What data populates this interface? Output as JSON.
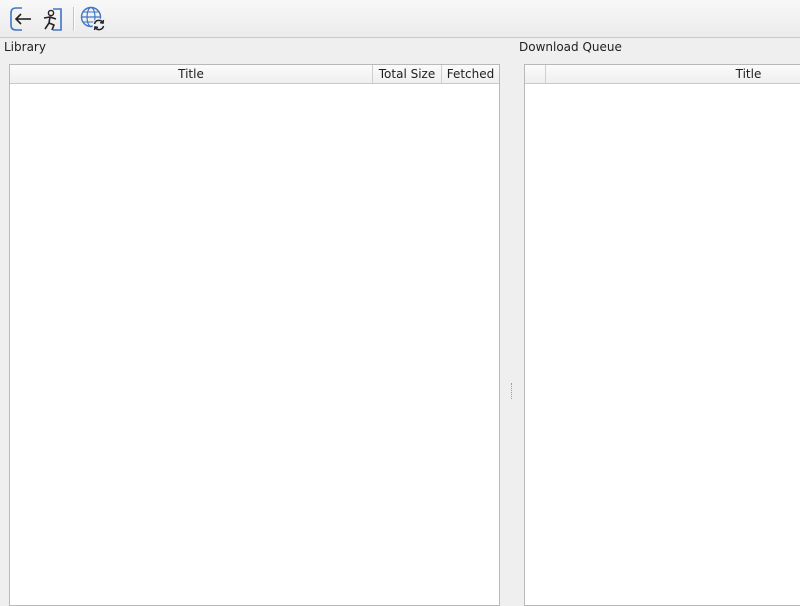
{
  "toolbar": {
    "buttons": [
      {
        "name": "back-icon"
      },
      {
        "name": "person-icon"
      },
      {
        "name": "globe-refresh-icon"
      }
    ]
  },
  "library": {
    "label": "Library",
    "columns": [
      "Title",
      "Total Size",
      "Fetched"
    ],
    "rows": []
  },
  "queue": {
    "label": "Download Queue",
    "columns": [
      "",
      "Title"
    ],
    "rows": []
  },
  "colors": {
    "icon_blue": "#3f76c6",
    "view_background": "#ffffff",
    "window_background": "#efefef"
  }
}
